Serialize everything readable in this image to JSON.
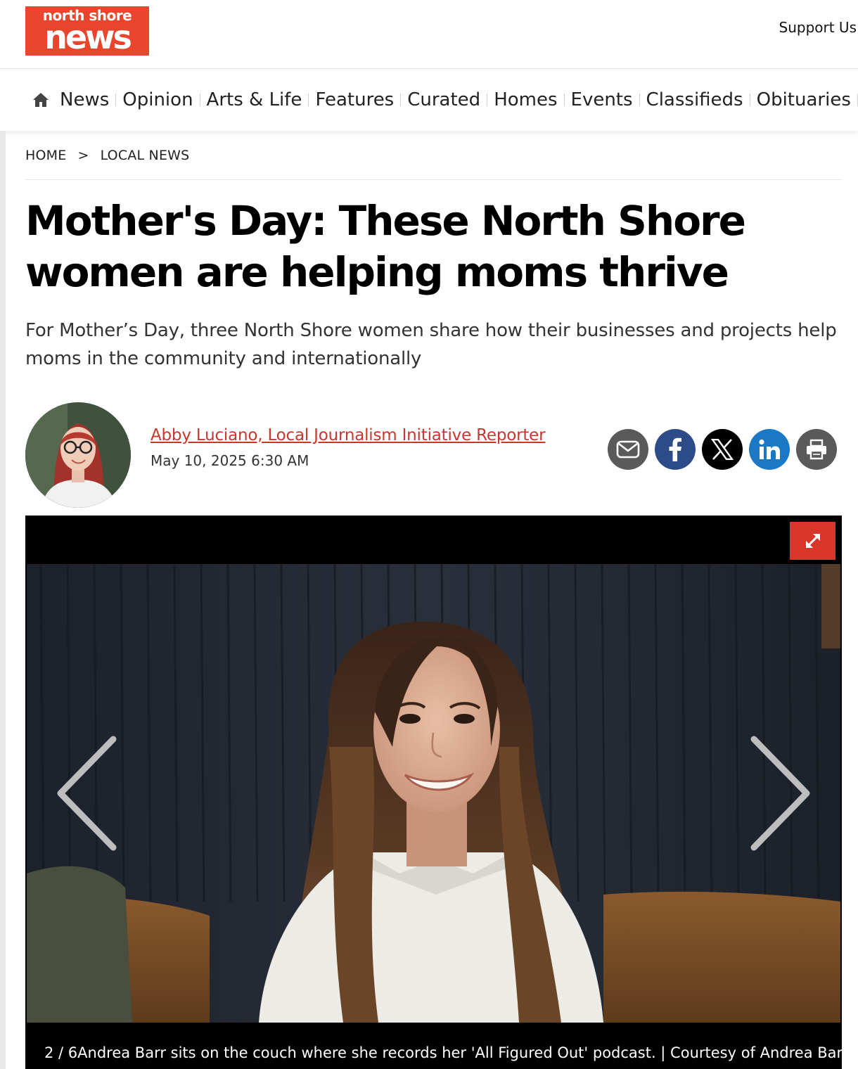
{
  "logo": {
    "line1": "north shore",
    "line2": "news"
  },
  "header": {
    "support_label": "Support Us"
  },
  "nav": {
    "items": [
      "News",
      "Opinion",
      "Arts & Life",
      "Features",
      "Curated",
      "Homes",
      "Events",
      "Classifieds",
      "Obituaries"
    ]
  },
  "breadcrumb": {
    "home": "HOME",
    "separator": ">",
    "section": "LOCAL NEWS"
  },
  "article": {
    "title": "Mother's Day: These North Shore women are helping moms thrive",
    "dek": "For Mother’s Day, three North Shore women share how their businesses and projects help moms in the community and internationally",
    "author": "Abby Luciano, Local Journalism Initiative Reporter",
    "date": "May 10, 2025 6:30 AM"
  },
  "share": {
    "buttons": [
      {
        "icon": "email-icon",
        "color": "#5a5a5a"
      },
      {
        "icon": "facebook-icon",
        "color": "#2d4b88"
      },
      {
        "icon": "x-icon",
        "color": "#000000"
      },
      {
        "icon": "linkedin-icon",
        "color": "#1b78c4"
      },
      {
        "icon": "print-icon",
        "color": "#5a5a5a"
      }
    ]
  },
  "gallery": {
    "counter": "2 / 6",
    "caption": "Andrea Barr sits on the couch where she records her 'All Figured Out' podcast. | Courtesy of Andrea Barr",
    "expand_color": "#d9362b"
  },
  "colors": {
    "brand": "#e8452c",
    "link": "#c8372d"
  }
}
